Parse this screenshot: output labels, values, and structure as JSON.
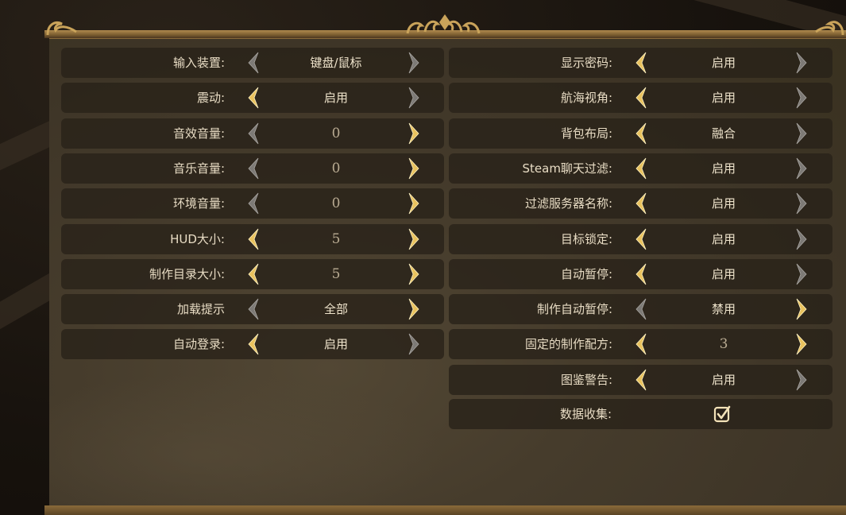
{
  "colors": {
    "arrow_active": "#e9c25e",
    "arrow_inactive": "#7d7a76",
    "label_text": "#e8dcc4",
    "panel_bg": "#463c2c",
    "frame_gold": "#b08a4e"
  },
  "left_settings": [
    {
      "label": "输入装置:",
      "value": "键盘/鼠标",
      "left_arrow": "inactive",
      "right_arrow": "inactive"
    },
    {
      "label": "震动:",
      "value": "启用",
      "left_arrow": "active",
      "right_arrow": "inactive"
    },
    {
      "label": "音效音量:",
      "value": "0",
      "left_arrow": "inactive",
      "right_arrow": "active"
    },
    {
      "label": "音乐音量:",
      "value": "0",
      "left_arrow": "inactive",
      "right_arrow": "active"
    },
    {
      "label": "环境音量:",
      "value": "0",
      "left_arrow": "inactive",
      "right_arrow": "active"
    },
    {
      "label": "HUD大小:",
      "value": "5",
      "left_arrow": "active",
      "right_arrow": "active"
    },
    {
      "label": "制作目录大小:",
      "value": "5",
      "left_arrow": "active",
      "right_arrow": "active"
    },
    {
      "label": "加载提示",
      "value": "全部",
      "left_arrow": "inactive",
      "right_arrow": "active"
    },
    {
      "label": "自动登录:",
      "value": "启用",
      "left_arrow": "active",
      "right_arrow": "inactive"
    }
  ],
  "right_settings": [
    {
      "label": "显示密码:",
      "value": "启用",
      "left_arrow": "active",
      "right_arrow": "inactive"
    },
    {
      "label": "航海视角:",
      "value": "启用",
      "left_arrow": "active",
      "right_arrow": "inactive"
    },
    {
      "label": "背包布局:",
      "value": "融合",
      "left_arrow": "active",
      "right_arrow": "inactive"
    },
    {
      "label": "Steam聊天过滤:",
      "value": "启用",
      "left_arrow": "active",
      "right_arrow": "inactive"
    },
    {
      "label": "过滤服务器名称:",
      "value": "启用",
      "left_arrow": "active",
      "right_arrow": "inactive"
    },
    {
      "label": "目标锁定:",
      "value": "启用",
      "left_arrow": "active",
      "right_arrow": "inactive"
    },
    {
      "label": "自动暂停:",
      "value": "启用",
      "left_arrow": "active",
      "right_arrow": "inactive"
    },
    {
      "label": "制作自动暂停:",
      "value": "禁用",
      "left_arrow": "inactive",
      "right_arrow": "active"
    },
    {
      "label": "固定的制作配方:",
      "value": "3",
      "left_arrow": "active",
      "right_arrow": "active"
    },
    {
      "label": "图鉴警告:",
      "value": "启用",
      "left_arrow": "active",
      "right_arrow": "inactive"
    }
  ],
  "data_collection": {
    "label": "数据收集:",
    "checked": true,
    "icon": "checkbox-checked-icon"
  }
}
